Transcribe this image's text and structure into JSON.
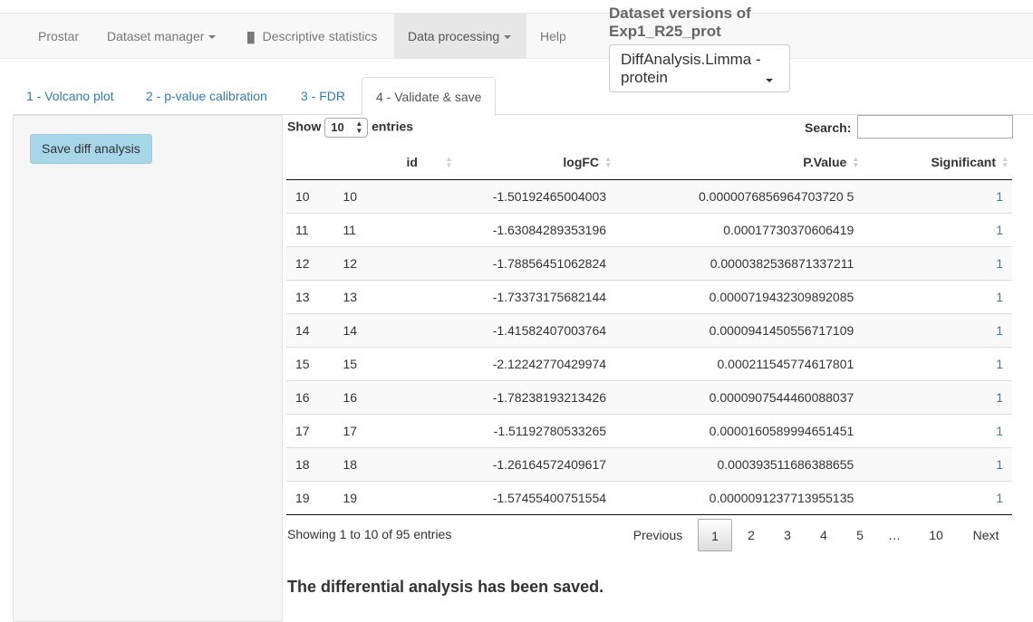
{
  "nav": {
    "items": [
      "Prostar",
      "Dataset manager",
      "Descriptive statistics",
      "Data processing",
      "Help"
    ]
  },
  "versions": {
    "label": "Dataset versions of Exp1_R25_prot",
    "line1": "Dataset versions of",
    "line2": "Exp1_R25_prot",
    "selected_line1": "DiffAnalysis.Limma -",
    "selected_line2": "protein"
  },
  "tabs": [
    "1 - Volcano plot",
    "2 - p-value calibration",
    "3 - FDR",
    "4 - Validate & save"
  ],
  "sidebar": {
    "save_button": "Save diff analysis"
  },
  "table": {
    "show_label": "Show",
    "entries_label": "entries",
    "length": "10",
    "search_label": "Search:",
    "search_value": "",
    "columns": [
      "",
      "id",
      "logFC",
      "P.Value",
      "Significant"
    ],
    "rows": [
      [
        "10",
        "10",
        "-1.50192465004003",
        "0.0000076856964703720 5",
        "1"
      ],
      [
        "11",
        "11",
        "-1.63084289353196",
        "0.00017730370606419",
        "1"
      ],
      [
        "12",
        "12",
        "-1.78856451062824",
        "0.0000382536871337211",
        "1"
      ],
      [
        "13",
        "13",
        "-1.73373175682144",
        "0.0000719432309892085",
        "1"
      ],
      [
        "14",
        "14",
        "-1.41582407003764",
        "0.0000941450556717109",
        "1"
      ],
      [
        "15",
        "15",
        "-2.12242770429974",
        "0.000211545774617801",
        "1"
      ],
      [
        "16",
        "16",
        "-1.78238193213426",
        "0.0000907544460088037",
        "1"
      ],
      [
        "17",
        "17",
        "-1.51192780533265",
        "0.0000160589994651451",
        "1"
      ],
      [
        "18",
        "18",
        "-1.26164572409617",
        "0.000393511686388655",
        "1"
      ],
      [
        "19",
        "19",
        "-1.57455400751554",
        "0.0000091237713955135",
        "1"
      ]
    ],
    "info": "Showing 1 to 10 of 95 entries",
    "pagination": {
      "previous": "Previous",
      "pages": [
        "1",
        "2",
        "3",
        "4",
        "5",
        "…",
        "10"
      ],
      "next": "Next"
    }
  },
  "message": "The differential analysis has been saved."
}
